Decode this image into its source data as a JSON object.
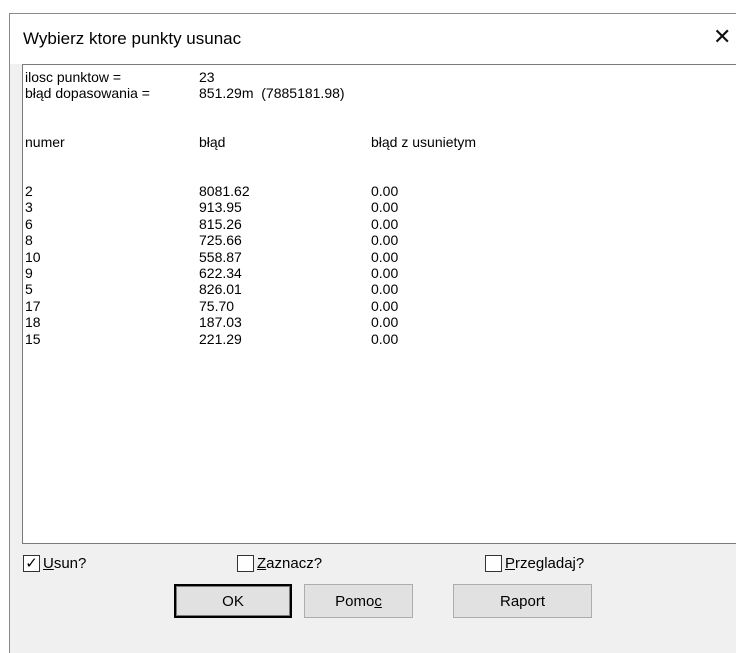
{
  "window": {
    "title": "Wybierz ktore punkty usunac",
    "close_glyph": "✕"
  },
  "summary": {
    "count_label": "ilosc punktow =",
    "count_value": "23",
    "fit_label": "błąd dopasowania =",
    "fit_value": "851.29m  (7885181.98)"
  },
  "columns": [
    "numer",
    "błąd",
    "błąd z usunietym"
  ],
  "rows": [
    {
      "numer": "2",
      "blad": "8081.62",
      "blad_usun": "0.00"
    },
    {
      "numer": "3",
      "blad": "913.95",
      "blad_usun": "0.00"
    },
    {
      "numer": "6",
      "blad": "815.26",
      "blad_usun": "0.00"
    },
    {
      "numer": "8",
      "blad": "725.66",
      "blad_usun": "0.00"
    },
    {
      "numer": "10",
      "blad": "558.87",
      "blad_usun": "0.00"
    },
    {
      "numer": "9",
      "blad": "622.34",
      "blad_usun": "0.00"
    },
    {
      "numer": "5",
      "blad": "826.01",
      "blad_usun": "0.00"
    },
    {
      "numer": "17",
      "blad": "75.70",
      "blad_usun": "0.00"
    },
    {
      "numer": "18",
      "blad": "187.03",
      "blad_usun": "0.00"
    },
    {
      "numer": "15",
      "blad": "221.29",
      "blad_usun": "0.00"
    }
  ],
  "checkboxes": {
    "usun": {
      "accel": "U",
      "rest": "sun?",
      "checked": true
    },
    "zaznacz": {
      "accel": "Z",
      "rest": "aznacz?",
      "checked": false
    },
    "przegladaj": {
      "accel": "P",
      "rest": "rzegladaj?",
      "checked": false
    }
  },
  "buttons": {
    "ok": "OK",
    "pomoc_pre": "Pomo",
    "pomoc_accel": "c",
    "raport": "Raport"
  },
  "check_glyph": "✓"
}
